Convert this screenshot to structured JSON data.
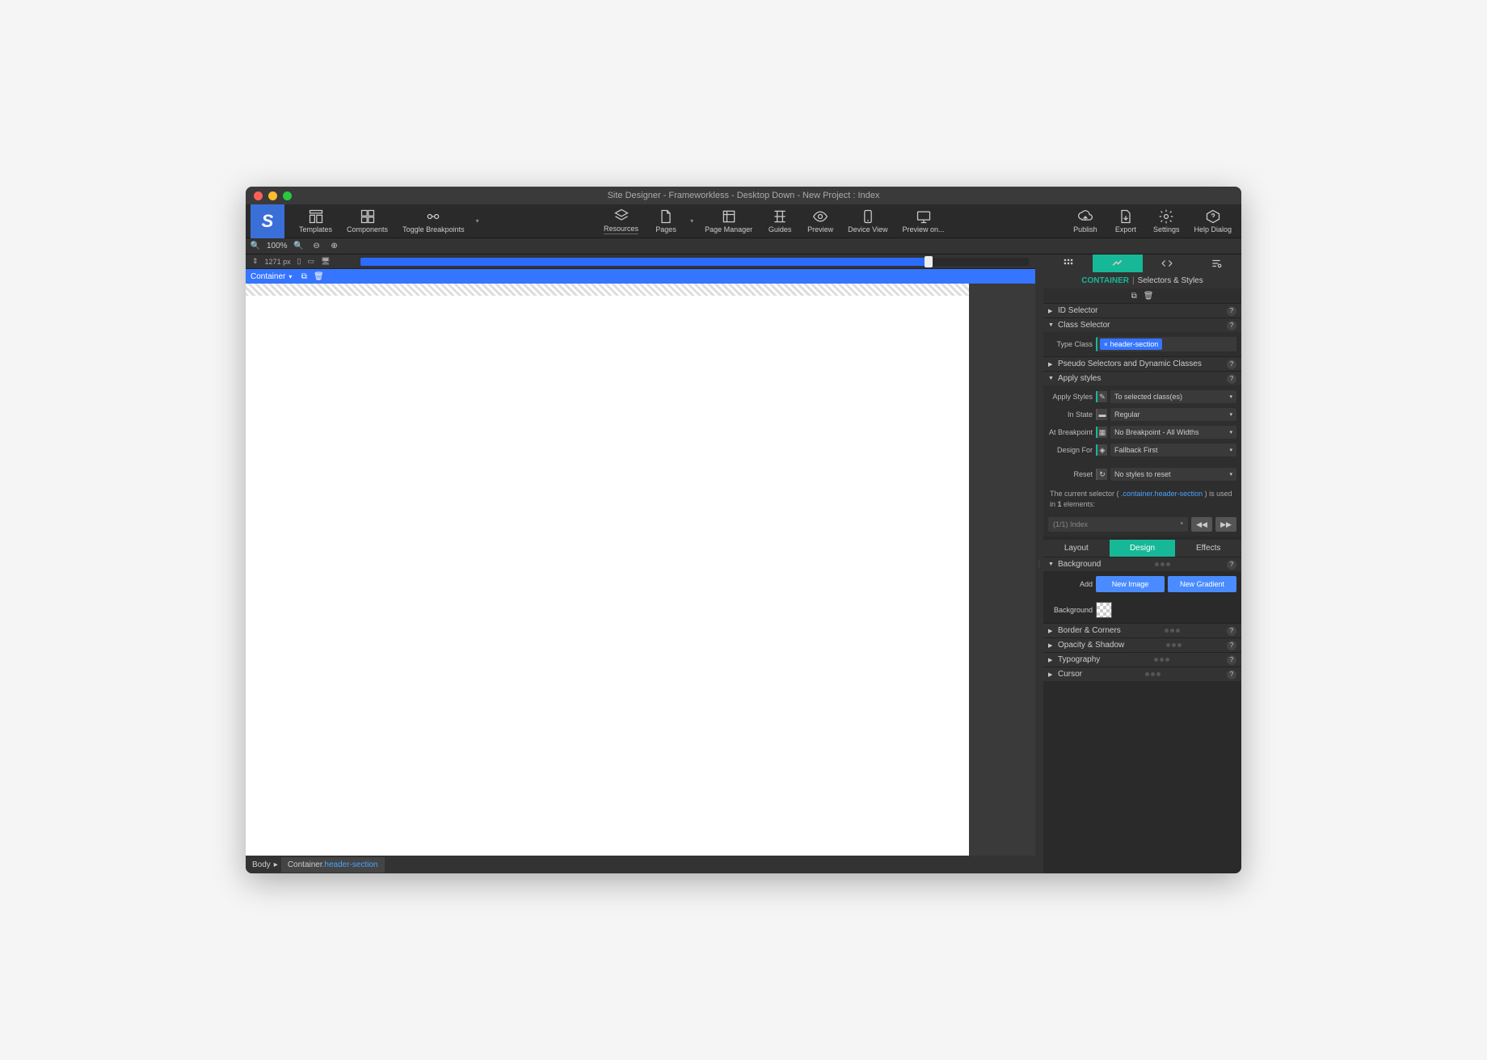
{
  "window_title": "Site Designer - Frameworkless - Desktop Down - New Project : Index",
  "toolbar": {
    "left": [
      "Templates",
      "Components",
      "Toggle Breakpoints"
    ],
    "center": [
      "Resources",
      "Pages",
      "Page Manager",
      "Guides",
      "Preview",
      "Device View",
      "Preview on..."
    ],
    "right": [
      "Publish",
      "Export",
      "Settings",
      "Help Dialog"
    ]
  },
  "zoom": {
    "level": "100%"
  },
  "ruler": {
    "width": "1271 px"
  },
  "selection": {
    "label": "Container"
  },
  "breadcrumb": {
    "body": "Body",
    "container": "Container",
    "class": ".header-section"
  },
  "side": {
    "header": {
      "entity": "CONTAINER",
      "sub": "Selectors & Styles"
    },
    "sections": {
      "id_selector": "ID Selector",
      "class_selector": "Class Selector",
      "pseudo": "Pseudo Selectors and Dynamic Classes",
      "apply_styles": "Apply styles",
      "background": "Background",
      "border": "Border & Corners",
      "opacity": "Opacity & Shadow",
      "typography": "Typography",
      "cursor": "Cursor"
    },
    "type_class": {
      "label": "Type Class",
      "chip": "header-section"
    },
    "apply": {
      "apply_label": "Apply Styles",
      "apply_value": "To selected class(es)",
      "state_label": "In State",
      "state_value": "Regular",
      "bp_label": "At Breakpoint",
      "bp_value": "No Breakpoint - All Widths",
      "design_label": "Design For",
      "design_value": "Fallback First",
      "reset_label": "Reset",
      "reset_value": "No styles to reset"
    },
    "info": {
      "prefix": "The current selector ( ",
      "selector": ".container.header-section",
      "suffix": " ) is used in ",
      "count": "1",
      "suffix2": " elements:",
      "usage": "(1/1) Index"
    },
    "tabs": {
      "layout": "Layout",
      "design": "Design",
      "effects": "Effects"
    },
    "bg": {
      "add": "Add",
      "new_image": "New Image",
      "new_gradient": "New Gradient",
      "background": "Background"
    }
  }
}
